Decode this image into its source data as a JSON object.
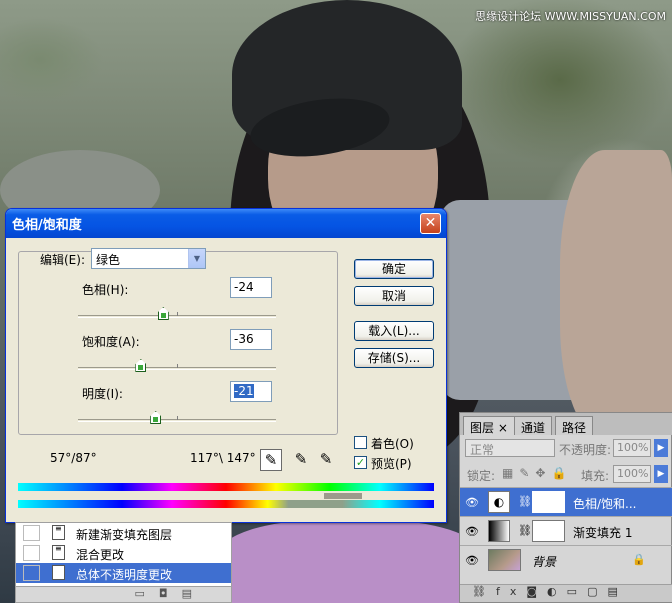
{
  "watermark": "思缘设计论坛 WWW.MISSYUAN.COM",
  "dialog": {
    "title": "色相/饱和度",
    "close_glyph": "✕",
    "edit_label": "编辑(E):",
    "edit_value": "绿色",
    "hue_label": "色相(H):",
    "hue_value": "-24",
    "saturation_label": "饱和度(A):",
    "saturation_value": "-36",
    "lightness_label": "明度(I):",
    "lightness_value": "-21",
    "ok": "确定",
    "cancel": "取消",
    "load": "载入(L)...",
    "save": "存储(S)...",
    "colorize": "着色(O)",
    "preview": "预览(P)",
    "preview_checked": "✓",
    "range_left": "57°/87°",
    "range_right": "117°\\ 147°",
    "slider_levels": {
      "hue": -24,
      "saturation": -36,
      "lightness": -21
    }
  },
  "history": {
    "items": [
      "新建渐变填充图层",
      "混合更改",
      "总体不透明度更改"
    ]
  },
  "layers": {
    "tabs": [
      "图层 ×",
      "通道",
      "路径"
    ],
    "blend_mode": "正常",
    "opacity_label": "不透明度:",
    "opacity_value": "100%",
    "lock_label": "锁定:",
    "fill_label": "填充:",
    "fill_value": "100%",
    "items": [
      {
        "name": "色相/饱和...",
        "icon": "adjustment-icon"
      },
      {
        "name": "渐变填充 1",
        "icon": "gradient-icon"
      },
      {
        "name": "背景",
        "icon": "photo-icon"
      }
    ]
  }
}
